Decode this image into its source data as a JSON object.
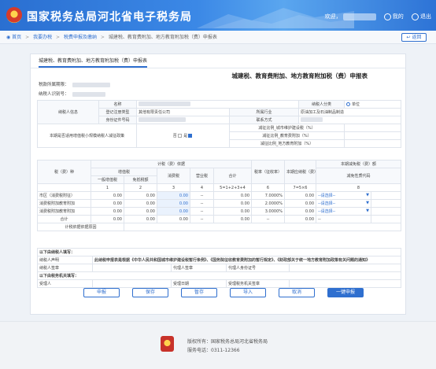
{
  "header": {
    "title": "国家税务总局河北省电子税务局",
    "welcome": "欢迎，",
    "menu_label": "我的",
    "logout_label": "退出"
  },
  "breadcrumb": {
    "home": "首页",
    "item1": "我要办税",
    "item2": "税费申报及缴纳",
    "current": "城建税、教育费附加、地方教育附加税（费）申报表",
    "back_label": "返回"
  },
  "tab_label": "城建税、教育费附加、地方教育附加税（费）申报表",
  "form_title": "城建税、教育费附加、地方教育附加税（费）申报表",
  "meta": {
    "period_label": "税款所属期限：",
    "taxpayer_id_label": "纳税人识别号："
  },
  "info": {
    "taxpayer_info": "纳税人信息",
    "name_label": "名称",
    "taxpayer_type_label": "纳税人分类",
    "taxpayer_type_value": "单位",
    "reg_type_label": "登记注册类型",
    "reg_type_value": "其他有限责任公司",
    "industry_label": "所属行业",
    "industry_value": "原油加工及石油制品制造",
    "id_type_label": "身份证件号码",
    "contact_label": "联系方式",
    "small_policy_label": "本期是否适用增值税小规模纳税人减征政策",
    "checkbox_no": "否",
    "checkbox_yes": "是",
    "reduce1": "减征比例_城市维护建设税（%）",
    "reduce2": "减征比例_教育费附加（%）",
    "reduce3": "减征比例_地方教育附加（%）"
  },
  "table": {
    "tax_item_label": "税（费）种",
    "basis_label": "计税（费）依据",
    "vat_label": "增值税",
    "general_vat": "一般增值税",
    "exempt_vat": "免抵税额",
    "consumption_tax": "消费税",
    "business_tax": "营业税",
    "total": "合计",
    "rate_label": "税率（征收率）",
    "payable_label": "本期应纳税（费）额",
    "reduce_label": "本期减免税（费）额",
    "reduce_code_label": "减免性质代码",
    "col_nums": [
      "1",
      "2",
      "3",
      "4",
      "5=1+2+3+4",
      "6",
      "7=5×6",
      "8"
    ],
    "rows": [
      {
        "name": "市区（消费税附征）",
        "c1": "0.00",
        "c2": "0.00",
        "c3": "0.00",
        "c4": "--",
        "c5": "0.00",
        "rate": "7.0000%",
        "c7": "0.00",
        "select": "--请选择--"
      },
      {
        "name": "消费税附加教育附加",
        "c1": "0.00",
        "c2": "0.00",
        "c3": "0.00",
        "c4": "--",
        "c5": "0.00",
        "rate": "2.0000%",
        "c7": "0.00",
        "select": "--请选择--"
      },
      {
        "name": "消费税附加教育附加",
        "c1": "0.00",
        "c2": "0.00",
        "c3": "0.00",
        "c4": "--",
        "c5": "0.00",
        "rate": "3.0000%",
        "c7": "0.00",
        "select": "--请选择--"
      }
    ],
    "total_row": {
      "name": "合计",
      "c1": "0.00",
      "c2": "0.00",
      "c3": "0.00",
      "c4": "--",
      "c5": "0.00",
      "rate": "--",
      "c7": "0.00",
      "select": "--"
    },
    "basis_note_label": "计税依据依据原因"
  },
  "declaration": {
    "section_label": "以下由纳税人填写：",
    "statement_label": "纳税人声明",
    "statement_text": "此纳税申报表是根据《中华人民共和国城市维护建设税暂行条例》、《国务院征收教育费附加的暂行规定》、《财政部关于统一地方教育附加政策有关问题的通知》",
    "signature_label": "纳税人签章",
    "agent_sign_label": "代理人签章",
    "agent_id_label": "代理人身份证号",
    "tax_section_label": "以下由税务机关填写：",
    "accepted_by": "受理人",
    "accept_date": "受理日期",
    "accept_office": "受理税务机关签章"
  },
  "buttons": {
    "b1": "申报",
    "b2": "保存",
    "b3": "暂存",
    "b4": "导入",
    "b5": "取消",
    "b6": "一键申报"
  },
  "footer": {
    "line1": "版权所有：国家税务总局河北省税务局",
    "line2": "服务电话：0311-12366"
  }
}
